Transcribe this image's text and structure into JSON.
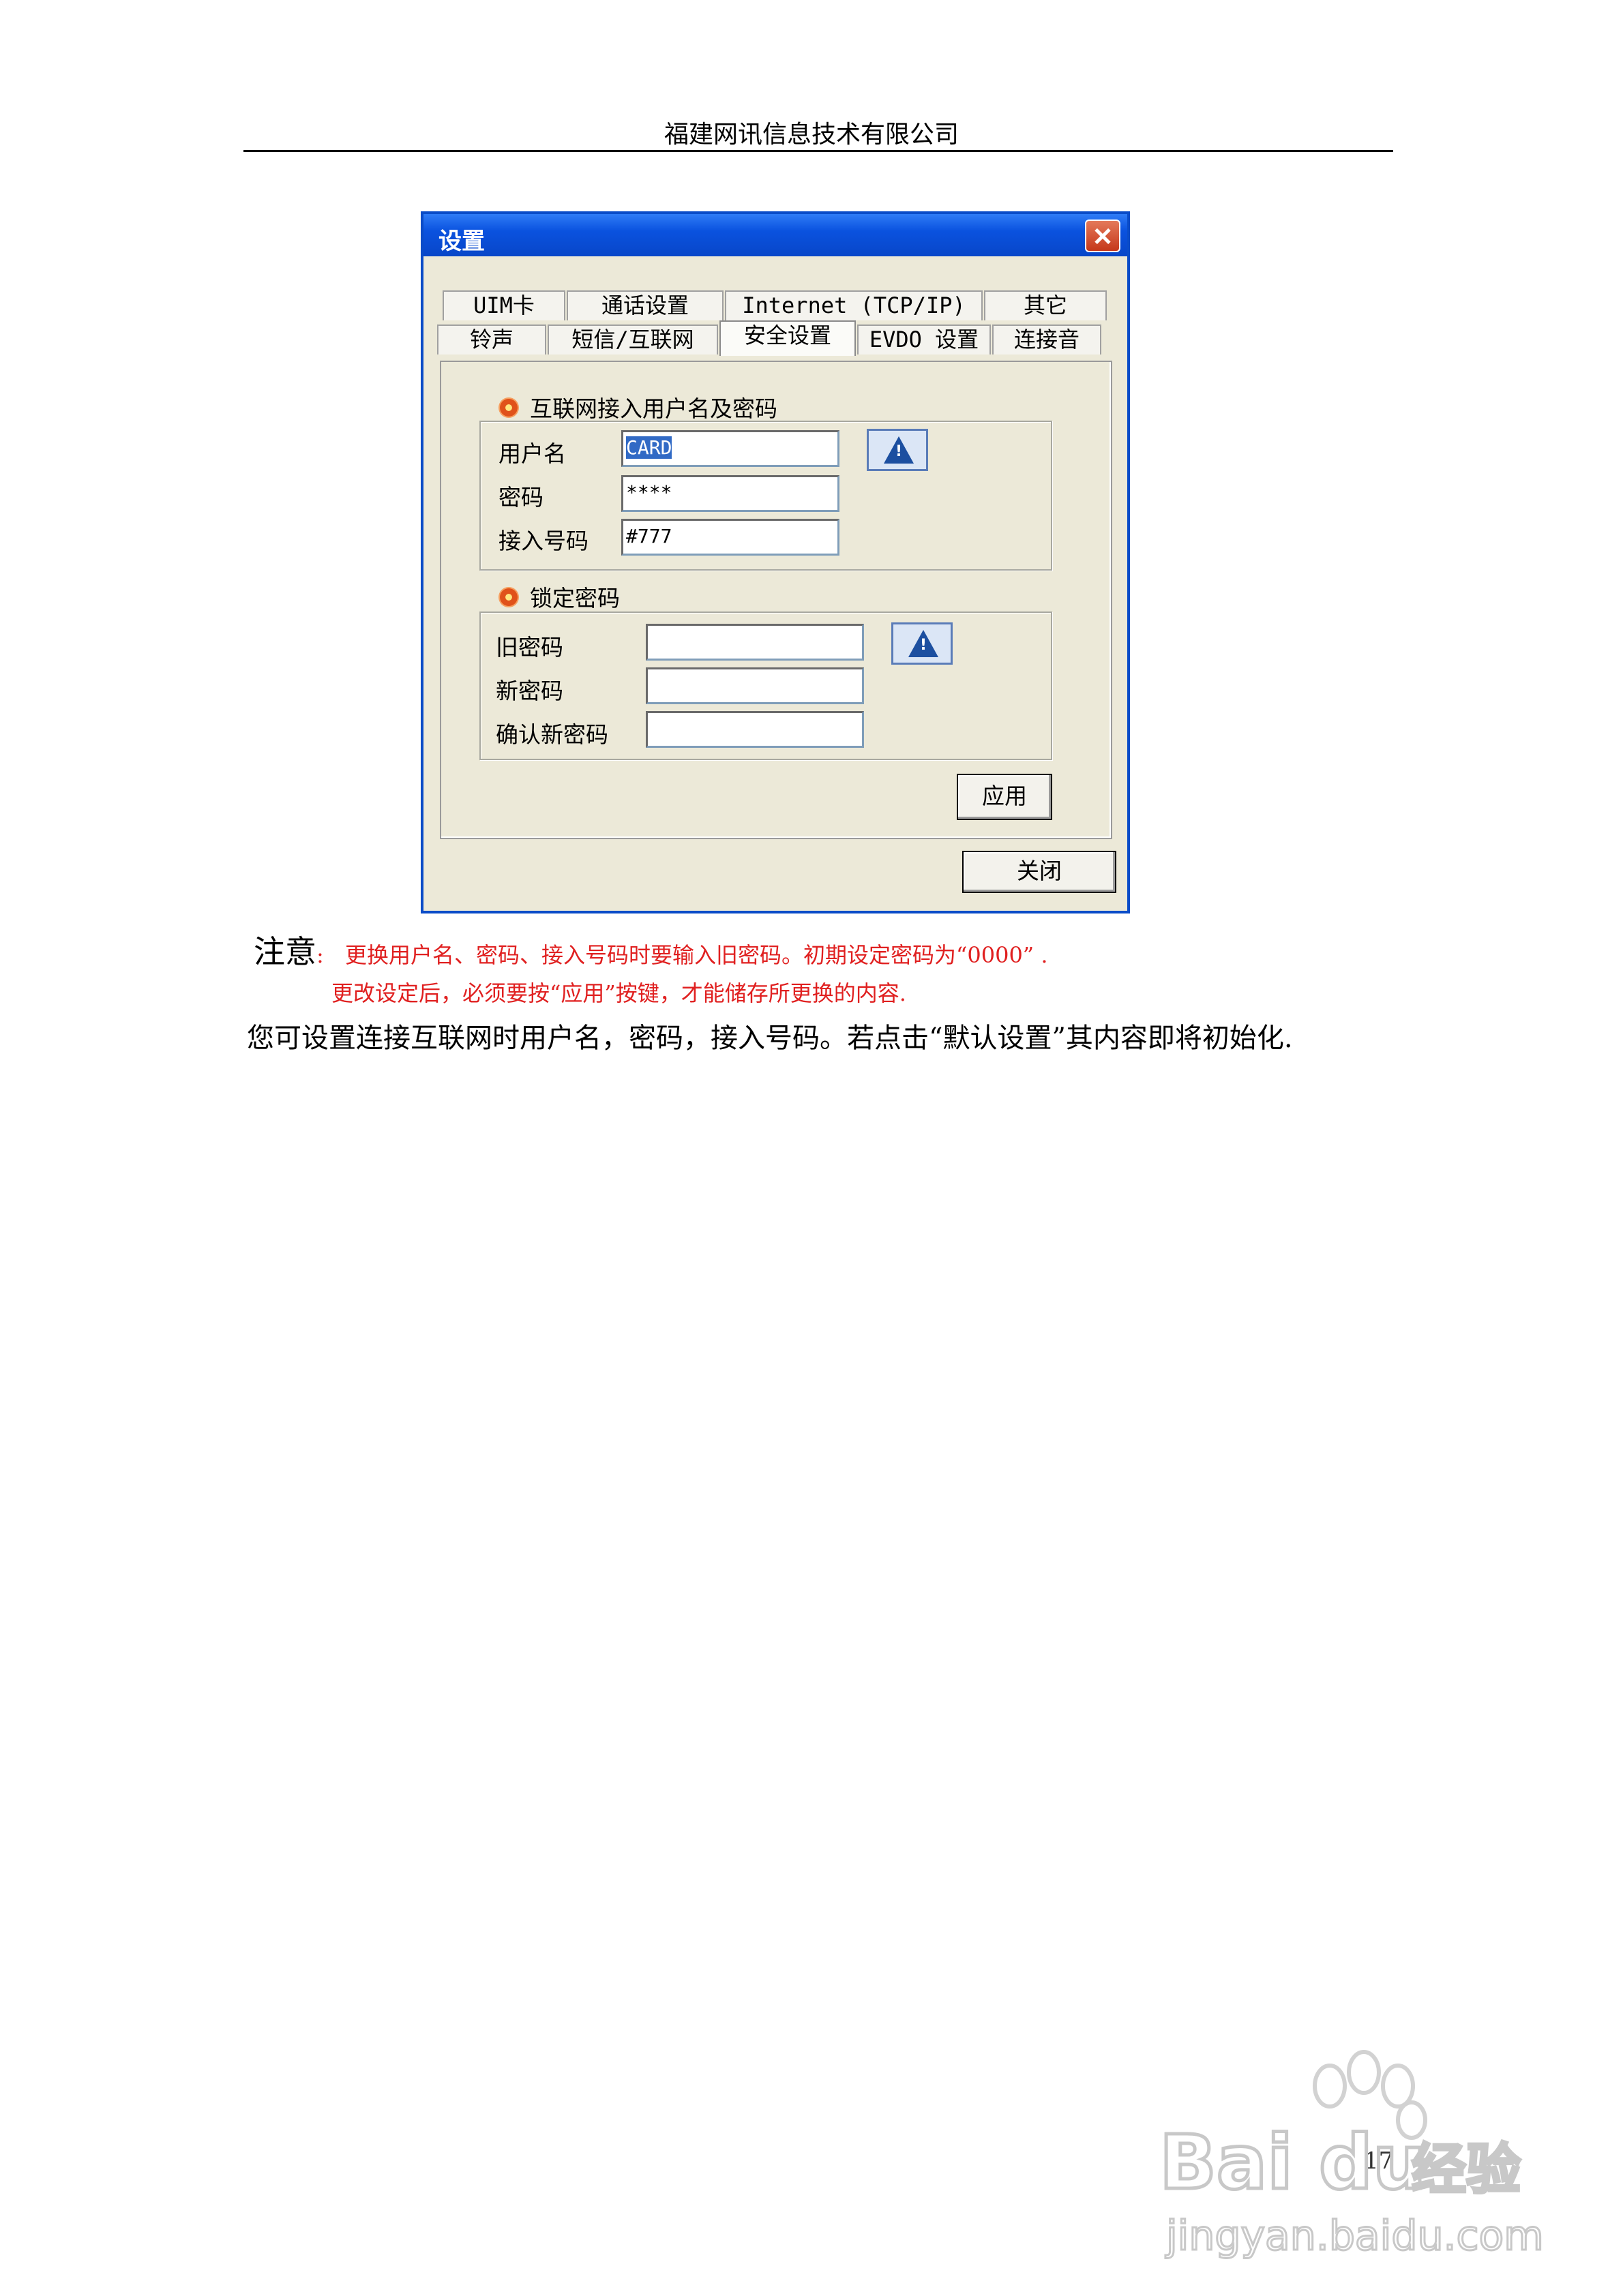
{
  "header": {
    "company": "福建网讯信息技术有限公司"
  },
  "dialog": {
    "title": "设置",
    "tabs_row1": [
      "UIM卡",
      "通话设置",
      "Internet (TCP/IP)",
      "其它"
    ],
    "tabs_row2": [
      "铃声",
      "短信/互联网",
      "安全设置",
      "EVDO 设置",
      "连接音"
    ],
    "active_tab": "安全设置",
    "internet_section": {
      "title": "互联网接入用户名及密码",
      "username_label": "用户名",
      "username_value": "CARD",
      "password_label": "密码",
      "password_value": "****",
      "access_number_label": "接入号码",
      "access_number_value": "#777"
    },
    "lock_section": {
      "title": "锁定密码",
      "old_password_label": "旧密码",
      "new_password_label": "新密码",
      "confirm_password_label": "确认新密码",
      "old_password_value": "",
      "new_password_value": "",
      "confirm_password_value": ""
    },
    "apply_label": "应用",
    "close_label": "关闭"
  },
  "note": {
    "label": "注意",
    "colon": ":",
    "line1": "更换用户名、密码、接入号码时要输入旧密码。初期设定密码为“0000” .",
    "line2": "更改设定后，必须要按“应用”按键，才能储存所更换的内容."
  },
  "body_text": "您可设置连接互联网时用户名，密码，接入号码。若点击“默认设置”其内容即将初始化.",
  "page_number": "17",
  "watermark": {
    "brand": "Bai du 经验",
    "url": "jingyan.baidu.com"
  },
  "colors": {
    "note_red": "#e02020",
    "title_bar_blue": "#0a52df"
  }
}
